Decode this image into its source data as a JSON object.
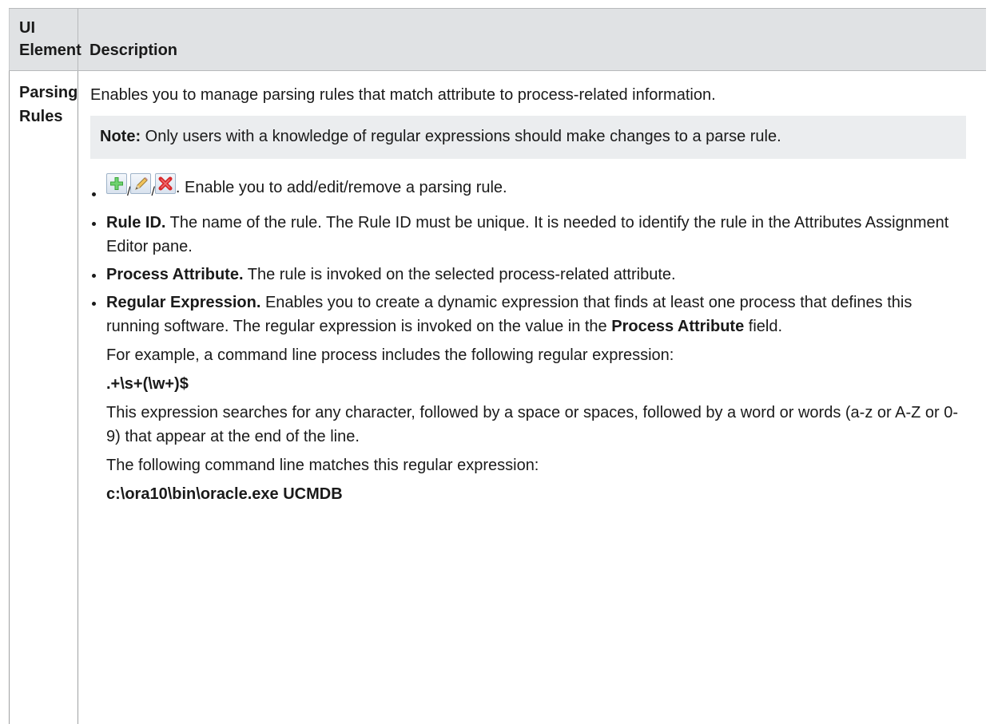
{
  "table": {
    "headers": {
      "element": "UI Element",
      "description": "Description"
    },
    "row": {
      "element": "Parsing Rules",
      "intro": "Enables you to manage parsing rules that match attribute to process-related information.",
      "note": {
        "label": "Note:",
        "text": " Only users with a knowledge of regular expressions should make changes to a parse rule."
      },
      "icons": [
        "add-icon",
        "edit-icon",
        "remove-icon"
      ],
      "icon_separator": "/",
      "icon_text": ". Enable you to add/edit/remove a parsing rule.",
      "items": [
        {
          "term": "Rule ID.",
          "text": " The name of the rule. The Rule ID must be unique. It is needed to identify the rule in the Attributes Assignment Editor pane."
        },
        {
          "term": "Process Attribute.",
          "text": " The rule is invoked on the selected process-related attribute."
        },
        {
          "term": "Regular Expression.",
          "text": " Enables you to create a dynamic expression that finds at least one process that defines this running software. The regular expression is invoked on the value in the ",
          "inline_bold": "Process Attribute",
          "text_end": " field.",
          "example_intro": "For example, a command line process includes the following regular expression:",
          "example_regex": ".+\\s+(\\w+)$",
          "explanation": "This expression searches for any character, followed by a space or spaces, followed by a word or words (a-z or A-Z or 0-9) that appear at the end of the line.",
          "match_intro": "The following command line matches this regular expression:",
          "match_example": "c:\\ora10\\bin\\oracle.exe UCMDB"
        }
      ]
    }
  },
  "colors": {
    "header_bg": "#e0e2e4",
    "note_bg": "#ebedef",
    "border": "#9fa1a3",
    "add_green": "#3aa53a",
    "remove_red": "#d8282a"
  }
}
